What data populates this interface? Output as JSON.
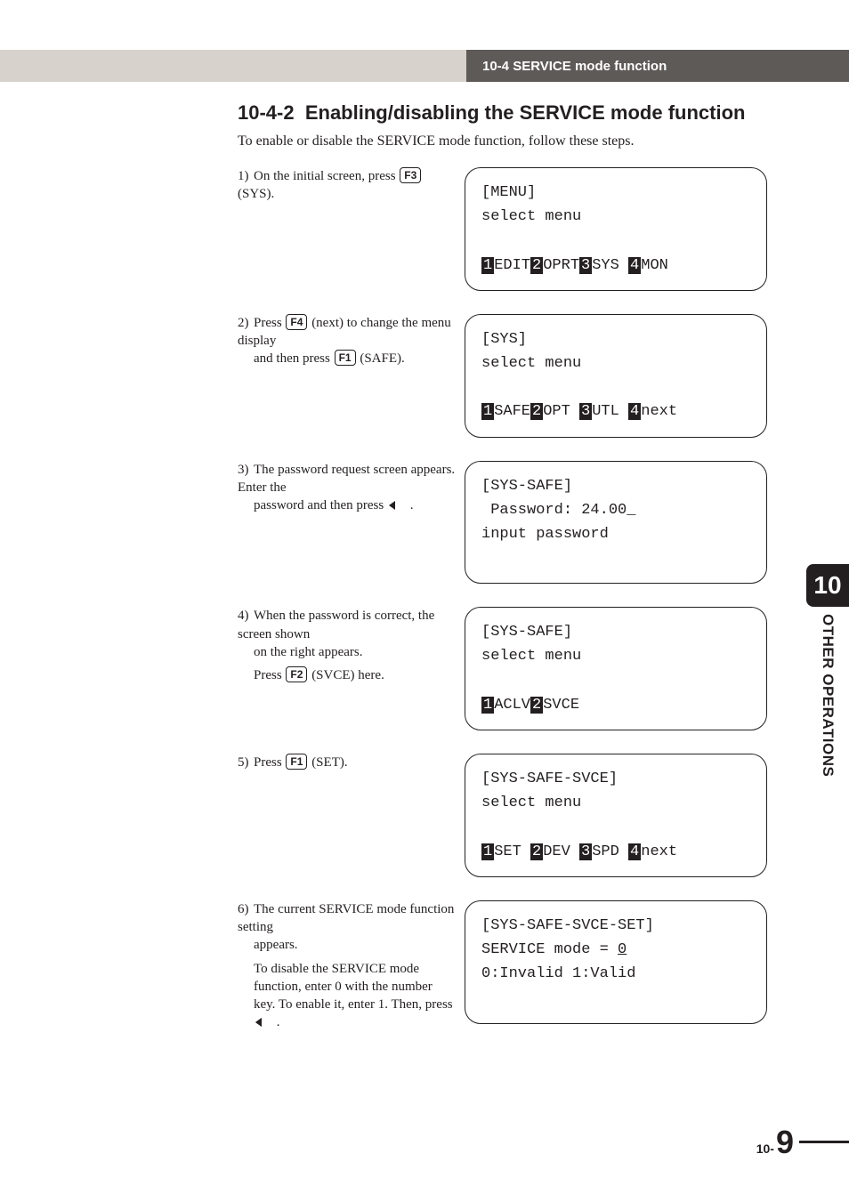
{
  "header": {
    "breadcrumb": "10-4 SERVICE mode function"
  },
  "section": {
    "number": "10-4-2",
    "title": "Enabling/disabling the SERVICE mode function",
    "intro": "To enable or disable the SERVICE mode function, follow these steps."
  },
  "keys": {
    "F1": "F1",
    "F2": "F2",
    "F3": "F3",
    "F4": "F4"
  },
  "steps": [
    {
      "num": "1)",
      "prefix": "On the initial screen, press ",
      "key": "F3",
      "suffix": " (SYS).",
      "lcd": {
        "l1": "[MENU]",
        "l2": "select menu",
        "l3": "",
        "softkeys": [
          {
            "n": "1",
            "t": "EDIT"
          },
          {
            "n": "2",
            "t": "OPRT"
          },
          {
            "n": "3",
            "t": "SYS "
          },
          {
            "n": "4",
            "t": "MON"
          }
        ]
      }
    },
    {
      "num": "2)",
      "line1_a": "Press ",
      "line1_key": "F4",
      "line1_b": " (next) to change the menu display",
      "line2_a": "and then press ",
      "line2_key": "F1",
      "line2_b": " (SAFE).",
      "lcd": {
        "l1": "[SYS]",
        "l2": "select menu",
        "l3": "",
        "softkeys": [
          {
            "n": "1",
            "t": "SAFE"
          },
          {
            "n": "2",
            "t": "OPT "
          },
          {
            "n": "3",
            "t": "UTL "
          },
          {
            "n": "4",
            "t": "next"
          }
        ]
      }
    },
    {
      "num": "3)",
      "text_a": "The password request screen appears. Enter the",
      "text_b": "password and then press ",
      "text_c": " .",
      "lcd": {
        "l1": "[SYS-SAFE]",
        "l2": " Password: 24.00_",
        "l3": "input password",
        "softkeys": []
      }
    },
    {
      "num": "4)",
      "text_a": "When the password is correct, the screen shown",
      "text_b": "on the right appears.",
      "extra_a": "Press ",
      "extra_key": "F2",
      "extra_b": " (SVCE) here.",
      "lcd": {
        "l1": "[SYS-SAFE]",
        "l2": "select menu",
        "l3": "",
        "softkeys": [
          {
            "n": "1",
            "t": "ACLV"
          },
          {
            "n": "2",
            "t": "SVCE"
          }
        ]
      }
    },
    {
      "num": "5)",
      "prefix": "Press ",
      "key": "F1",
      "suffix": " (SET).",
      "lcd": {
        "l1": "[SYS-SAFE-SVCE]",
        "l2": "select menu",
        "l3": "",
        "softkeys": [
          {
            "n": "1",
            "t": "SET "
          },
          {
            "n": "2",
            "t": "DEV "
          },
          {
            "n": "3",
            "t": "SPD "
          },
          {
            "n": "4",
            "t": "next"
          }
        ]
      }
    },
    {
      "num": "6)",
      "text_a": "The current SERVICE mode function setting",
      "text_b": "appears.",
      "para2_a": "To disable the SERVICE mode function, enter",
      "para2_b": "0 with the number key. To enable it, enter 1.",
      "para2_c": "Then, press ",
      "para2_d": " .",
      "lcd": {
        "l1": "[SYS-SAFE-SVCE-SET]",
        "l2_a": "SERVICE mode = ",
        "l2_b": "0",
        "l3": "0:Invalid 1:Valid",
        "softkeys": []
      }
    }
  ],
  "sidebar": {
    "chapter": "10",
    "label": "OTHER OPERATIONS"
  },
  "footer": {
    "pre": "10-",
    "page": "9"
  }
}
